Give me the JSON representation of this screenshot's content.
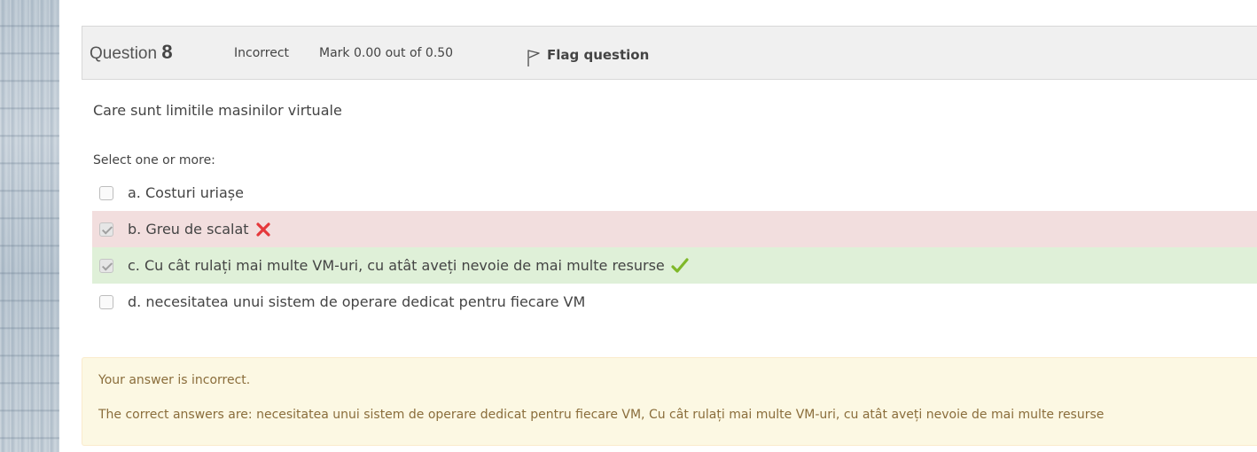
{
  "question": {
    "label": "Question",
    "number": "8",
    "state": "Incorrect",
    "grade": "Mark 0.00 out of 0.50",
    "flag_label": "Flag question",
    "text": "Care sunt limitile masinilor virtuale",
    "prompt": "Select one or more:"
  },
  "answers": [
    {
      "label": "a. Costuri uriașe",
      "checked": false,
      "status": "none"
    },
    {
      "label": "b. Greu de scalat",
      "checked": true,
      "status": "incorrect"
    },
    {
      "label": "c. Cu cât rulați mai multe VM-uri, cu atât aveți nevoie de mai multe resurse",
      "checked": true,
      "status": "correct"
    },
    {
      "label": "d. necesitatea unui sistem de operare dedicat pentru fiecare VM",
      "checked": false,
      "status": "none"
    }
  ],
  "outcome": {
    "feedback": "Your answer is incorrect.",
    "right_answer": "The correct answers are: necesitatea unui sistem de operare dedicat pentru fiecare VM, Cu cât rulați mai multe VM-uri, cu atât aveți nevoie de mai multe resurse"
  },
  "colors": {
    "incorrect_bg": "#f2dede",
    "correct_bg": "#dff0d8",
    "incorrect_icon": "#e5383b",
    "correct_icon": "#7fb829",
    "outcome_bg": "#fcf8e3"
  },
  "icons": {
    "flag": "flag-icon",
    "incorrect": "cross-icon",
    "correct": "check-icon"
  }
}
